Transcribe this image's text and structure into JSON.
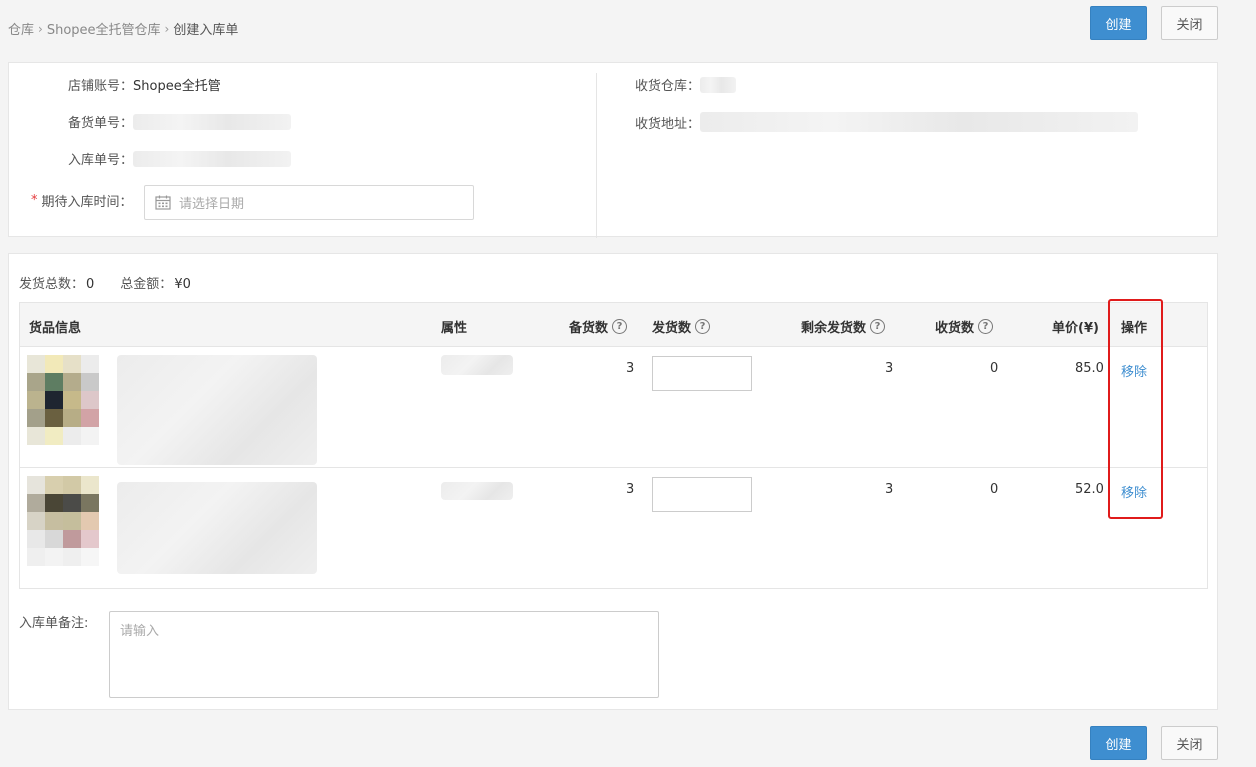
{
  "breadcrumb": {
    "items": [
      "仓库",
      "Shopee全托管仓库"
    ],
    "current": "创建入库单"
  },
  "actions": {
    "create_label": "创建",
    "close_label": "关闭"
  },
  "form": {
    "shop_account_label": "店铺账号：",
    "shop_account_value": "Shopee全托管",
    "stock_no_label": "备货单号：",
    "inbound_no_label": "入库单号：",
    "expected_time_label": "期待入库时间：",
    "date_placeholder": "请选择日期",
    "warehouse_label": "收货仓库：",
    "address_label": "收货地址："
  },
  "summary": {
    "total_ship_label": "发货总数：",
    "total_ship_value": "0",
    "total_amount_label": "总金额：",
    "total_amount_value": "¥0"
  },
  "table": {
    "headers": {
      "goods": "货品信息",
      "attr": "属性",
      "stock_qty": "备货数",
      "ship_qty": "发货数",
      "remaining": "剩余发货数",
      "received": "收货数",
      "unit_price": "单价(¥)",
      "action": "操作"
    },
    "rows": [
      {
        "stock_qty": "3",
        "remaining": "3",
        "received": "0",
        "unit_price": "85.0",
        "action": "移除"
      },
      {
        "stock_qty": "3",
        "remaining": "3",
        "received": "0",
        "unit_price": "52.0",
        "action": "移除"
      }
    ]
  },
  "remark": {
    "label": "入库单备注:",
    "placeholder": "请输入"
  },
  "colors": {
    "primary": "#3e8ed0",
    "highlight": "#e01b1b"
  },
  "icons": {
    "calendar": "calendar-icon",
    "help": "question-circle-icon",
    "chevron": "chevron-right-icon"
  }
}
